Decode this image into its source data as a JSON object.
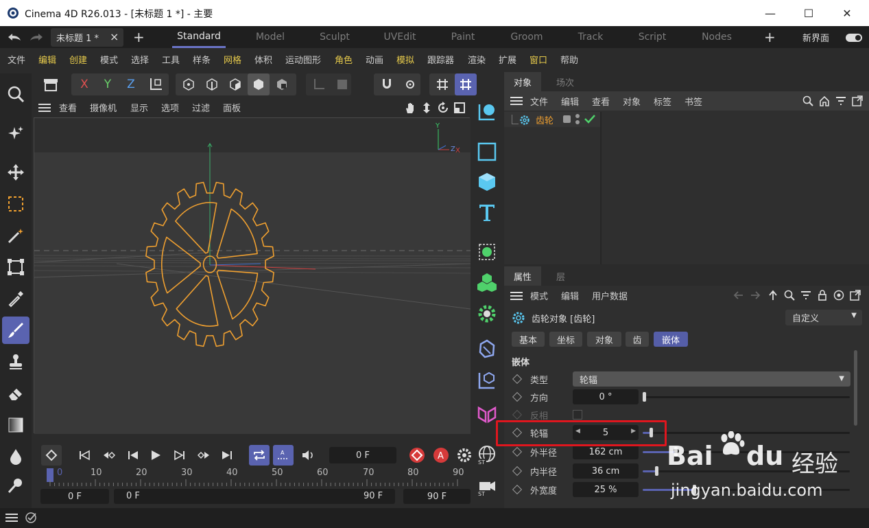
{
  "window": {
    "title": "Cinema 4D R26.013 - [未标题 1 *] - 主要",
    "minimize": "—",
    "maximize": "☐",
    "close": "✕"
  },
  "tabs": {
    "doc_tab": "未标题 1 *",
    "close_symbol": "×",
    "add_symbol": "+",
    "layouts": [
      "Standard",
      "Model",
      "Sculpt",
      "UVEdit",
      "Paint",
      "Groom",
      "Track",
      "Script",
      "Nodes"
    ],
    "active_layout": "Standard",
    "add_layout": "+",
    "new_ui_label": "新界面"
  },
  "menu": {
    "items": [
      "文件",
      "编辑",
      "创建",
      "模式",
      "选择",
      "工具",
      "样条",
      "网格",
      "体积",
      "运动图形",
      "角色",
      "动画",
      "模拟",
      "跟踪器",
      "渲染",
      "扩展",
      "窗口",
      "帮助"
    ],
    "highlighted": [
      "编辑",
      "创建",
      "网格",
      "角色",
      "模拟",
      "窗口"
    ]
  },
  "toolbar": {
    "axis_x": "X",
    "axis_y": "Y",
    "axis_z": "Z"
  },
  "viewport": {
    "menu": [
      "查看",
      "摄像机",
      "显示",
      "选项",
      "过滤",
      "面板"
    ],
    "axis_y_label": "Y",
    "axis_z_label": "Z",
    "axis_x_label": "X"
  },
  "timeline": {
    "current_frame": "0 F",
    "ruler": [
      "0",
      "10",
      "20",
      "30",
      "40",
      "50",
      "60",
      "70",
      "80",
      "90"
    ],
    "start_field": "0 F",
    "range_start": "0 F",
    "range_end": "90 F",
    "end_field": "90 F"
  },
  "object_manager": {
    "tab_active": "对象",
    "tab_inactive": "场次",
    "menu": [
      "文件",
      "编辑",
      "查看",
      "对象",
      "标签",
      "书签"
    ],
    "object_name": "齿轮"
  },
  "attributes": {
    "tab_active": "属性",
    "tab_inactive": "层",
    "menu": [
      "模式",
      "编辑",
      "用户数据"
    ],
    "object_title": "齿轮对象 [齿轮]",
    "preset": "自定义",
    "subtabs": [
      "基本",
      "坐标",
      "对象",
      "齿",
      "嵌体"
    ],
    "active_subtab": "嵌体",
    "section": "嵌体",
    "props": [
      {
        "label": "类型",
        "value": "轮辐",
        "kind": "dropdown"
      },
      {
        "label": "方向",
        "value": "0 °",
        "kind": "slider",
        "fill": 0.0
      },
      {
        "label": "反相",
        "value": "",
        "kind": "checkbox",
        "disabled": true
      },
      {
        "label": "轮辐",
        "value": "5",
        "kind": "stepper",
        "fill": 0.05
      },
      {
        "label": "外半径",
        "value": "162 cm",
        "kind": "slider",
        "fill": 0.16
      },
      {
        "label": "内半径",
        "value": "36 cm",
        "kind": "slider",
        "fill": 0.07
      },
      {
        "label": "外宽度",
        "value": "25 %",
        "kind": "slider",
        "fill": 0.25
      }
    ]
  },
  "watermark": {
    "brand": "Bai",
    "brand_tail": "du",
    "brand_cn": "经验",
    "url": "jingyan.baidu.com"
  },
  "colors": {
    "accent": "#5a63b0",
    "highlight_menu": "#e5c94b",
    "gear": "#f0a030",
    "object_name": "#f0a030",
    "highlight_box": "#e0161e",
    "check": "#4fd16b"
  }
}
